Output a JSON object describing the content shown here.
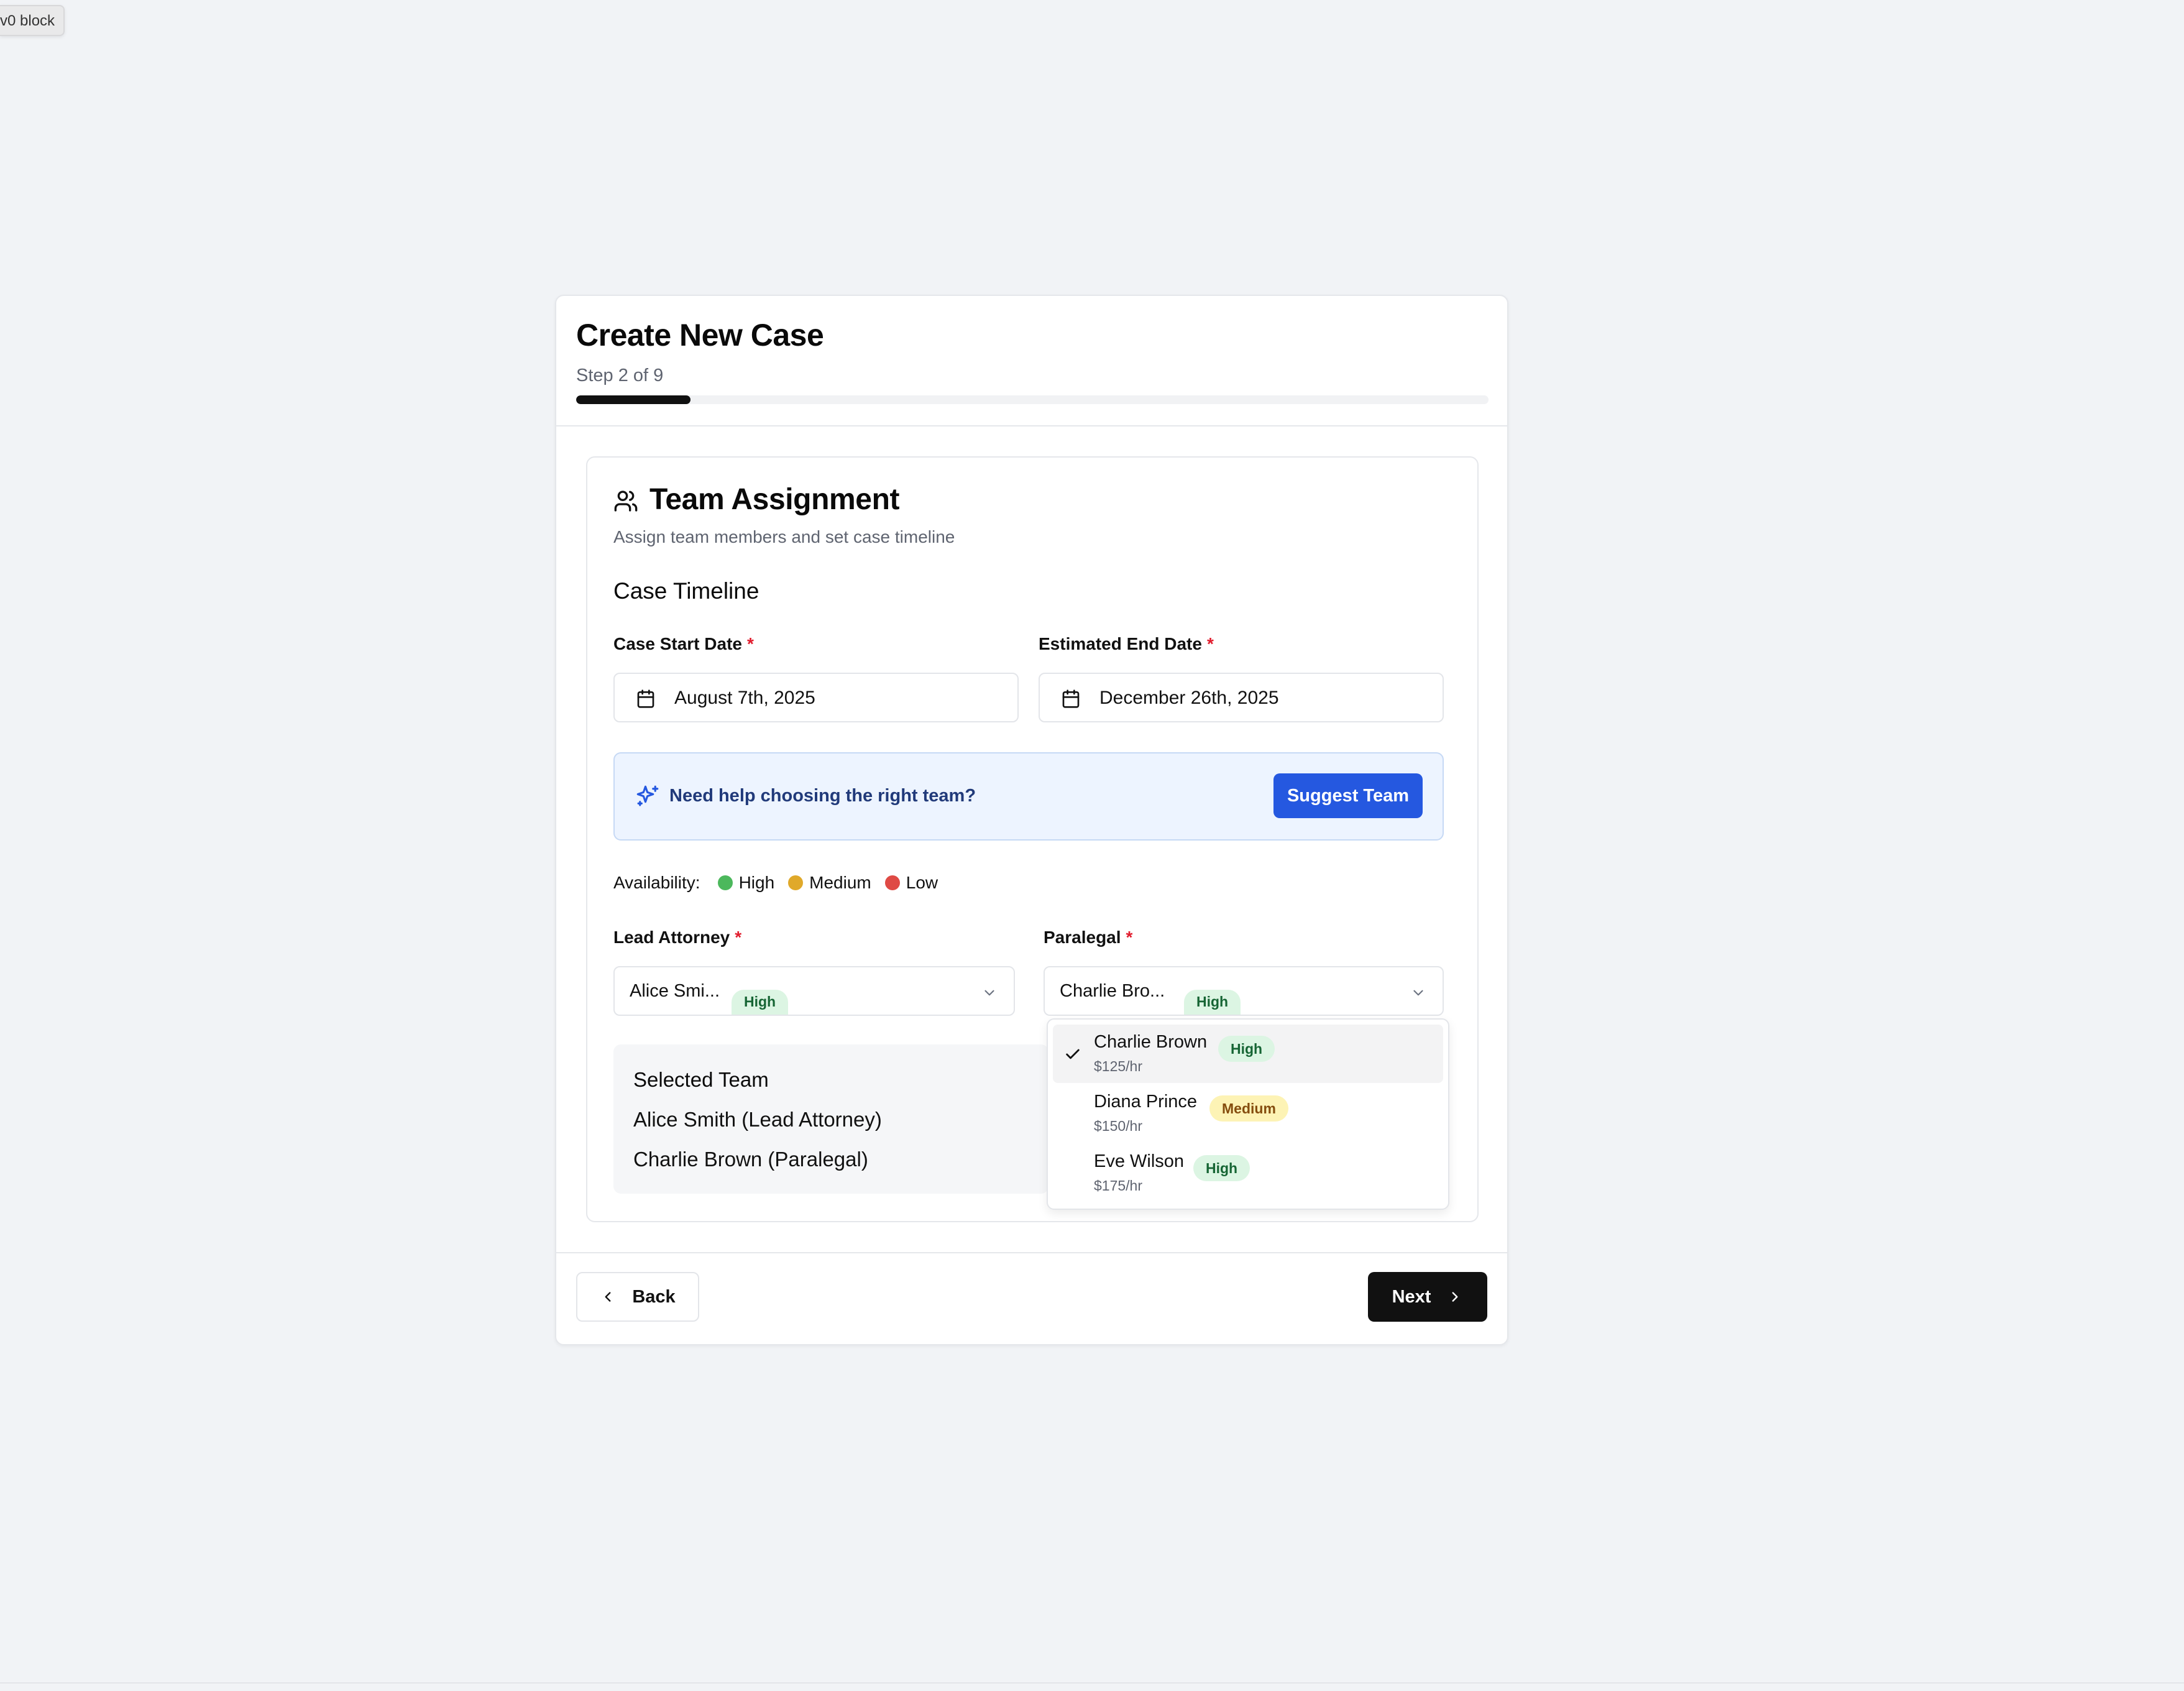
{
  "v0_badge": "v0 block",
  "header": {
    "title": "Create New Case",
    "step": "Step 2 of 9",
    "progress_fraction": 0.125
  },
  "section": {
    "title": "Team Assignment",
    "description": "Assign team members and set case timeline",
    "timeline_heading": "Case Timeline",
    "start_label": "Case Start Date",
    "start_value": "August 7th, 2025",
    "end_label": "Estimated End Date",
    "end_value": "December 26th, 2025",
    "required_marker": "*"
  },
  "help": {
    "text": "Need help choosing the right team?",
    "button": "Suggest Team"
  },
  "availability": {
    "label": "Availability:",
    "levels": [
      {
        "label": "High",
        "color": "#4cb85c"
      },
      {
        "label": "Medium",
        "color": "#e0a92a"
      },
      {
        "label": "Low",
        "color": "#df4a45"
      }
    ]
  },
  "lead": {
    "label": "Lead Attorney",
    "value": "Alice Smi...",
    "badge": "High"
  },
  "paralegal": {
    "label": "Paralegal",
    "value": "Charlie Bro...",
    "badge": "High"
  },
  "selected_team": {
    "title": "Selected Team",
    "members": [
      "Alice Smith (Lead Attorney)",
      "Charlie Brown (Paralegal)"
    ]
  },
  "dropdown": {
    "options": [
      {
        "name": "Charlie Brown",
        "rate": "$125/hr",
        "badge": "High",
        "level": "high",
        "selected": true
      },
      {
        "name": "Diana Prince",
        "rate": "$150/hr",
        "badge": "Medium",
        "level": "medium",
        "selected": false
      },
      {
        "name": "Eve Wilson",
        "rate": "$175/hr",
        "badge": "High",
        "level": "high",
        "selected": false
      }
    ]
  },
  "footer": {
    "back": "Back",
    "next": "Next"
  }
}
